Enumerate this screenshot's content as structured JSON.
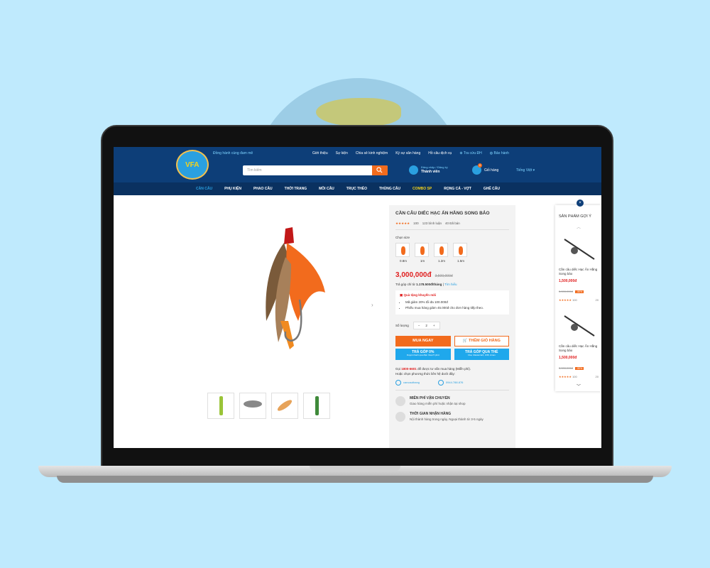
{
  "header": {
    "tagline": "Đồng hành cùng đam mê",
    "logo_text": "VFA",
    "nav": [
      "Giới thiệu",
      "Sự kiện",
      "Chia sẻ kinh nghiệm",
      "Ký sự săn hàng",
      "Hồ câu dịch vụ"
    ],
    "order_lookup": "Tra cứu ĐH",
    "warranty": "Bảo hành",
    "search_placeholder": "Tìm kiếm",
    "account_line": "Đăng nhập / Đăng ký",
    "account_label": "Thành viên",
    "cart_label": "Giỏ hàng",
    "cart_count": "0",
    "language": "Tiếng Việt ▾"
  },
  "categories": [
    "CẦN CÂU",
    "PHỤ KIỆN",
    "PHAO CÂU",
    "THỜI TRANG",
    "MỒI CÂU",
    "TRỤC THẺO",
    "THÙNG CÂU",
    "COMBO SP",
    "RỌNG CÁ - VỢT",
    "GHẾ CÂU"
  ],
  "product": {
    "title": "CẦN CÂU DIẾC HẠC ẤN HẰNG SONG BẢO",
    "stars": "★★★★★",
    "rating_count": "100",
    "reviews": "123 bình luận",
    "sold": "40 Đã bán",
    "size_label": "Chọn size",
    "sizes": [
      "0.8m",
      "1m",
      "1.2m",
      "1.5m"
    ],
    "price": "3,000,000đ",
    "old_price": "3,500,000đ",
    "installment_prefix": "Trả góp chỉ từ",
    "installment_value": "1.178.500đ/tháng",
    "installment_link": "Tìm hiểu",
    "gift_title": "Quà tặng khuyến mãi",
    "gifts": [
      "Mã giảm 20% tối đa 100.000đ",
      "Phiếu mua hàng giảm 45.000đ cho đơn hàng tiếp theo."
    ],
    "qty_label": "Số lượng",
    "qty": "2",
    "buy_now": "MUA NGAY",
    "add_cart": "THÊM GIỎ HÀNG",
    "inst0_title": "TRẢ GÓP 0%",
    "inst0_sub": "Duyệt nhanh qua điện thoại 5 phút",
    "instcard_title": "TRẢ GÓP QUA THẺ",
    "instcard_sub": "Visa, Mastercard, JCB, Amex",
    "hotline_prefix": "Gọi",
    "hotline": "1800-6601",
    "hotline_suffix": "để được tư vấn mua hàng (Miễn phí).",
    "contact_line": "Hoặc chọn phương thức liên hệ dưới đây:",
    "facebook": "cancauthang",
    "zalo": "0944.788.876",
    "shipping_title": "MIỄN PHÍ VẬN CHUYỂN",
    "shipping_desc": "Giao hàng miễn phí hoặc nhận tại shop",
    "delivery_title": "THỜI GIAN NHẬN HÀNG",
    "delivery_desc": "Nội thành hàng trong ngày, Ngoại thành từ 3-5 ngày"
  },
  "suggestions": {
    "title": "SẢN PHẨM GỢI Ý",
    "items": [
      {
        "name": "Cần câu diếc Hạc Ấn Hằng Song bảo",
        "price": "1,500,000đ",
        "old": "3,000,000đ",
        "discount": "-50%",
        "stars": "★★★★★",
        "count": "100",
        "sold": "20"
      },
      {
        "name": "Cần câu diếc Hạc Ấn Hằng Song bảo",
        "price": "1,500,000đ",
        "old": "3,000,000đ",
        "discount": "-50%",
        "stars": "★★★★★",
        "count": "100",
        "sold": "20"
      }
    ]
  },
  "colors": {
    "primary": "#0d3e78",
    "accent": "#f26b1d",
    "price": "#e02020",
    "link": "#2aa0e0"
  }
}
